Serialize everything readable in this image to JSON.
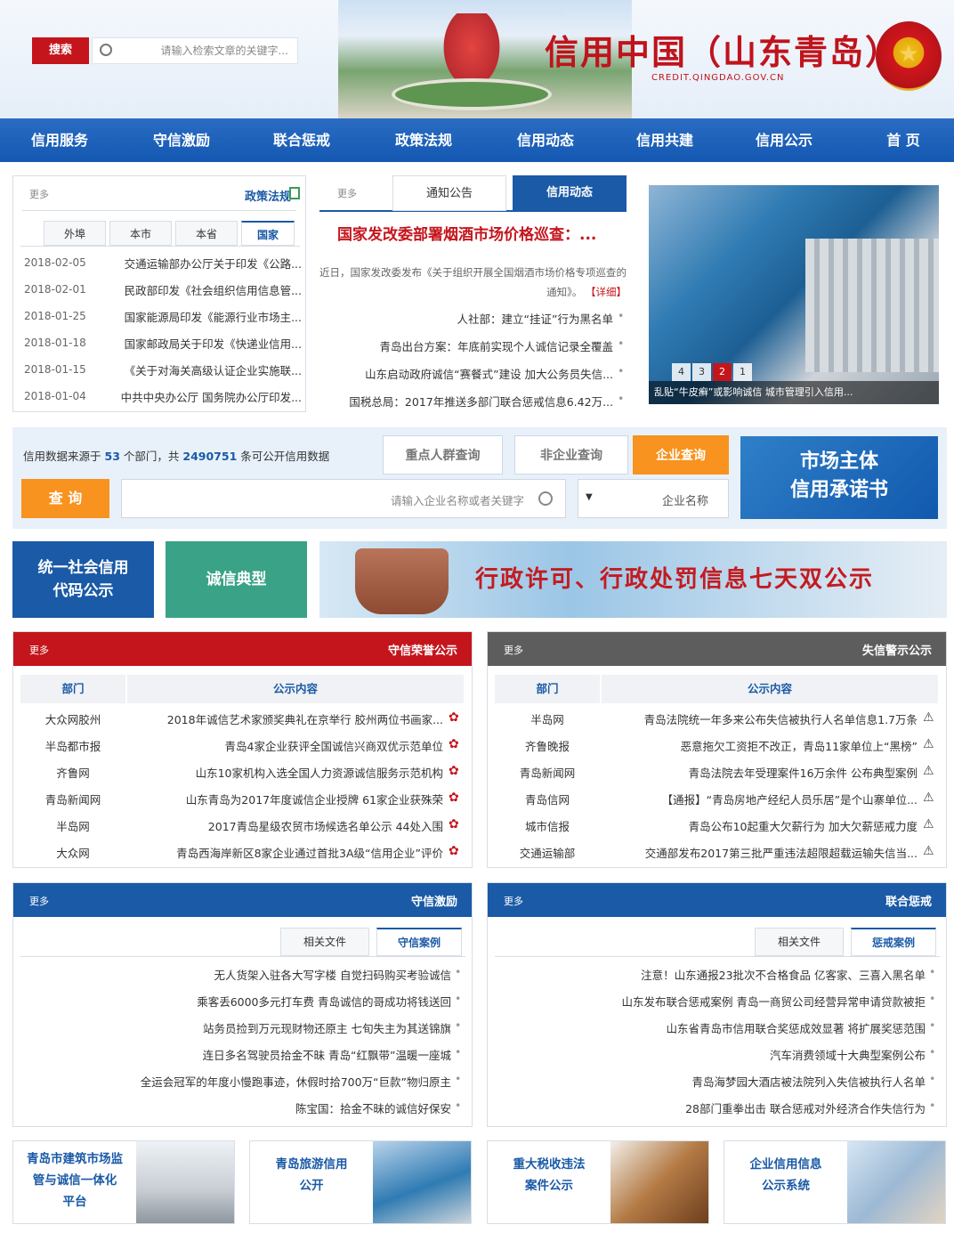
{
  "header": {
    "site_title": "信用中国（山东青岛）",
    "site_url": "CREDIT.QINGDAO.GOV.CN",
    "search_placeholder": "请输入检索文章的关键字...",
    "search_button": "搜索"
  },
  "nav": [
    "首 页",
    "信用公示",
    "信用共建",
    "信用动态",
    "政策法规",
    "联合惩戒",
    "守信激励",
    "信用服务"
  ],
  "policy": {
    "title": "政策法规",
    "more": "更多",
    "tabs": [
      "国家",
      "本省",
      "本市",
      "外埠"
    ],
    "items": [
      {
        "text": "交通运输部办公厅关于印发《公路...",
        "date": "2018-02-05"
      },
      {
        "text": "民政部印发《社会组织信用信息管...",
        "date": "2018-02-01"
      },
      {
        "text": "国家能源局印发《能源行业市场主...",
        "date": "2018-01-25"
      },
      {
        "text": "国家邮政局关于印发《快递业信用...",
        "date": "2018-01-18"
      },
      {
        "text": "《关于对海关高级认证企业实施联...",
        "date": "2018-01-15"
      },
      {
        "text": "中共中央办公厅 国务院办公厅印发...",
        "date": "2018-01-04"
      }
    ]
  },
  "dynamics": {
    "tabs": [
      "信用动态",
      "通知公告"
    ],
    "more": "更多",
    "headline": "国家发改委部署烟酒市场价格巡查：...",
    "summary": "近日，国家发改委发布《关于组织开展全国烟酒市场价格专项巡查的通知》。",
    "detail_link": "【详细】",
    "items": [
      "人社部：建立“挂证”行为黑名单",
      "青岛出台方案：年底前实现个人诚信记录全覆盖",
      "山东启动政府诚信“赛餐式”建设 加大公务员失信...",
      "国税总局：2017年推送多部门联合惩戒信息6.42万..."
    ]
  },
  "carousel": {
    "caption": "乱贴“牛皮癣”或影响诚信 城市管理引入信用...",
    "pages": [
      "1",
      "2",
      "3",
      "4"
    ],
    "active_page": "2"
  },
  "query": {
    "info_prefix": "信用数据来源于",
    "dept_count": "53",
    "info_mid": "个部门，共",
    "record_count": "2490751",
    "info_suffix": "条可公开信用数据",
    "buttons": [
      "企业查询",
      "非企业查询",
      "重点人群查询"
    ],
    "select_value": "企业名称",
    "input_placeholder": "请输入企业名称或者关键字",
    "query_button": "查 询",
    "promise_line1": "市场主体",
    "promise_line2": "信用承诺书"
  },
  "tiles": {
    "unified_code": "统一社会信用\n代码公示",
    "integrity": "诚信典型",
    "banner_text": "行政许可、行政处罚信息七天双公示"
  },
  "dishonest": {
    "title": "失信警示公示",
    "more": "更多",
    "col_content": "公示内容",
    "col_dept": "部门",
    "rows": [
      {
        "text": "青岛法院统一年多来公布失信被执行人名单信息1.7万条",
        "dept": "半岛网"
      },
      {
        "text": "恶意拖欠工资拒不改正，青岛11家单位上“黑榜”",
        "dept": "齐鲁晚报"
      },
      {
        "text": "青岛法院去年受理案件16万余件 公布典型案例",
        "dept": "青岛新闻网"
      },
      {
        "text": "【通报】“青岛房地产经纪人员乐居”是个山寨单位...",
        "dept": "青岛信网"
      },
      {
        "text": "青岛公布10起重大欠薪行为 加大欠薪惩戒力度",
        "dept": "城市信报"
      },
      {
        "text": "交通部发布2017第三批严重违法超限超载运输失信当...",
        "dept": "交通运输部"
      }
    ]
  },
  "honest": {
    "title": "守信荣誉公示",
    "more": "更多",
    "col_content": "公示内容",
    "col_dept": "部门",
    "rows": [
      {
        "text": "2018年诚信艺术家颁奖典礼在京举行 胶州两位书画家...",
        "dept": "大众网胶州"
      },
      {
        "text": "青岛4家企业获评全国诚信兴商双优示范单位",
        "dept": "半岛都市报"
      },
      {
        "text": "山东10家机构入选全国人力资源诚信服务示范机构",
        "dept": "齐鲁网"
      },
      {
        "text": "山东青岛为2017年度诚信企业授牌 61家企业获殊荣",
        "dept": "青岛新闻网"
      },
      {
        "text": "2017青岛星级农贸市场候选名单公示 44处入围",
        "dept": "半岛网"
      },
      {
        "text": "青岛西海岸新区8家企业通过首批3A级“信用企业”评价",
        "dept": "大众网"
      }
    ]
  },
  "joint_punish": {
    "title": "联合惩戒",
    "more": "更多",
    "tabs": [
      "惩戒案例",
      "相关文件"
    ],
    "items": [
      "注意！山东通报23批次不合格食品 亿客家、三喜入黑名单",
      "山东发布联合惩戒案例 青岛一商贸公司经营异常申请贷款被拒",
      "山东省青岛市信用联合奖惩成效显著 将扩展奖惩范围",
      "汽车消费领域十大典型案例公布",
      "青岛海梦园大酒店被法院列入失信被执行人名单",
      "28部门重拳出击 联合惩戒对外经济合作失信行为"
    ]
  },
  "incentive": {
    "title": "守信激励",
    "more": "更多",
    "tabs": [
      "守信案例",
      "相关文件"
    ],
    "items": [
      "无人货架入驻各大写字楼 自觉扫码购买考验诚信",
      "乘客丢6000多元打车费 青岛诚信的哥成功将钱送回",
      "站务员捡到万元现财物还原主 七旬失主为其送锦旗",
      "连日多名驾驶员拾金不昧 青岛“红飘带”温暖一座城",
      "全运会冠军的年度小慢跑事迹，休假时拾700万“巨款”物归原主",
      "陈宝国：拾金不昧的诚信好保安"
    ]
  },
  "bottom_cards": [
    {
      "label": "企业信用信息\n公示系统"
    },
    {
      "label": "重大税收违法\n案件公示"
    },
    {
      "label": "青岛旅游信用\n公开"
    },
    {
      "label": "青岛市建筑市场监\n管与诚信一体化\n平台"
    }
  ],
  "colors": {
    "nav_blue": "#1458b2",
    "brand_red": "#c4151c",
    "orange": "#f7931e",
    "teal": "#3aa387"
  }
}
